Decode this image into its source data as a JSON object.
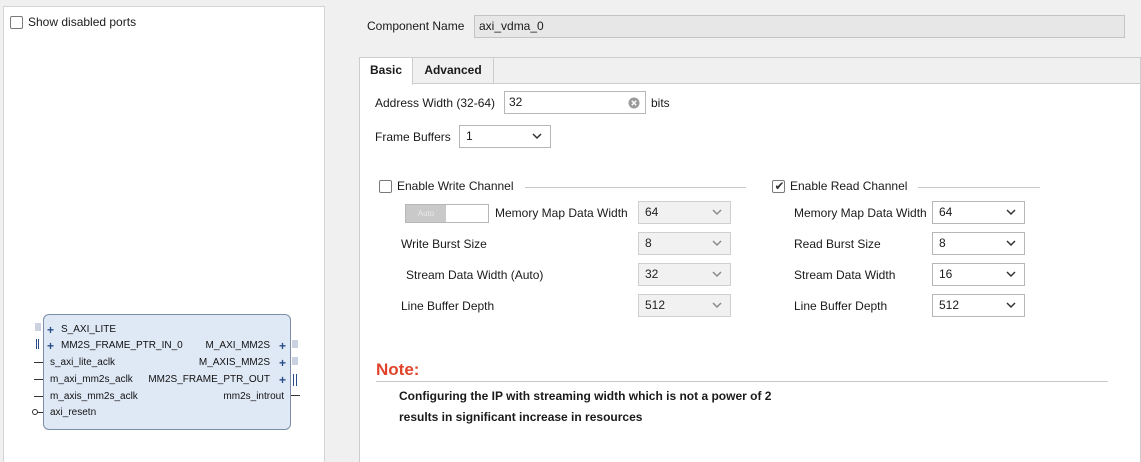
{
  "left_pane": {
    "show_disabled_ports": {
      "label": "Show disabled ports",
      "checked": false
    },
    "ip_block": {
      "left_ports": [
        "S_AXI_LITE",
        "MM2S_FRAME_PTR_IN_0",
        "s_axi_lite_aclk",
        "m_axi_mm2s_aclk",
        "m_axis_mm2s_aclk",
        "axi_resetn"
      ],
      "right_ports": [
        "M_AXI_MM2S",
        "M_AXIS_MM2S",
        "MM2S_FRAME_PTR_OUT",
        "mm2s_introut"
      ]
    }
  },
  "component_name": {
    "label": "Component Name",
    "value": "axi_vdma_0"
  },
  "tabs": [
    {
      "label": "Basic",
      "active": true
    },
    {
      "label": "Advanced",
      "active": false
    }
  ],
  "basic": {
    "address_width": {
      "label": "Address Width (32-64)",
      "value": "32",
      "unit": "bits"
    },
    "frame_buffers": {
      "label": "Frame Buffers",
      "value": "1"
    },
    "write_channel": {
      "label": "Enable Write Channel",
      "enabled": false,
      "auto_toggle_label": "Auto",
      "memory_map_data_width": {
        "label": "Memory Map Data Width",
        "value": "64"
      },
      "write_burst_size": {
        "label": "Write Burst Size",
        "value": "8"
      },
      "stream_data_width": {
        "label": "Stream Data Width (Auto)",
        "value": "32"
      },
      "line_buffer_depth": {
        "label": "Line Buffer Depth",
        "value": "512"
      }
    },
    "read_channel": {
      "label": "Enable Read Channel",
      "enabled": true,
      "memory_map_data_width": {
        "label": "Memory Map Data Width",
        "value": "64"
      },
      "read_burst_size": {
        "label": "Read Burst Size",
        "value": "8"
      },
      "stream_data_width": {
        "label": "Stream Data Width",
        "value": "16"
      },
      "line_buffer_depth": {
        "label": "Line Buffer Depth",
        "value": "512"
      }
    }
  },
  "note": {
    "title": "Note:",
    "line1": "Configuring the IP with streaming width which is not a power of 2",
    "line2": "results in significant increase in resources"
  },
  "colors": {
    "note_title": "#e0452b",
    "block_fill": "#dfe9f6",
    "port_plus": "#2a4d8a"
  }
}
